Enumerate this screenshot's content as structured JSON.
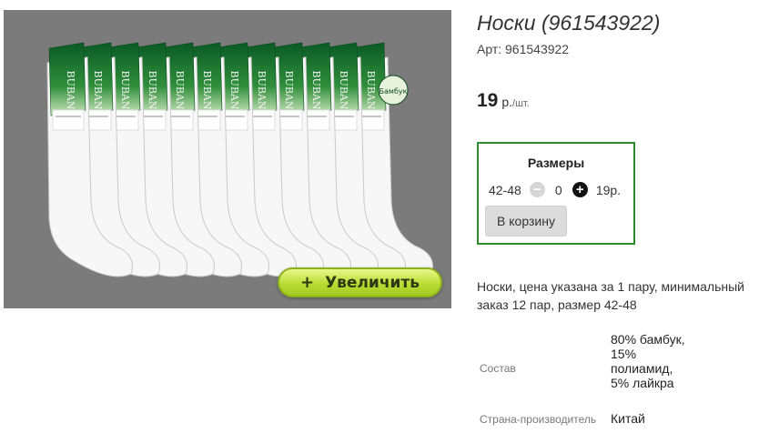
{
  "product": {
    "title": "Носки (961543922)",
    "article_label": "Арт:",
    "article_value": "961543922",
    "price_value": "19",
    "price_unit": "р.",
    "price_per": "/шт."
  },
  "image": {
    "brand_text": "BUBAN",
    "tag_text": "Бамбук",
    "label_text": "мужские носки",
    "zoom_button_label": "Увеличить",
    "zoom_button_icon": "+"
  },
  "sizes": {
    "title": "Размеры",
    "rows": [
      {
        "size": "42-48",
        "quantity": "0",
        "price": "19р.",
        "minus_icon": "−",
        "plus_icon": "+"
      }
    ],
    "cart_button_label": "В корзину"
  },
  "description": "Носки, цена указана за 1 пару, минимальный заказ 12 пар, размер 42-48",
  "properties": [
    {
      "label": "Состав",
      "value": "80% бамбук, 15% полиамид, 5% лайкра"
    },
    {
      "label": "Страна-производитель",
      "value": "Китай"
    }
  ],
  "colors": {
    "accent_border": "#2e8b2e",
    "zoom_button": "#b9dc35",
    "photo_background": "#7b7b7b"
  }
}
